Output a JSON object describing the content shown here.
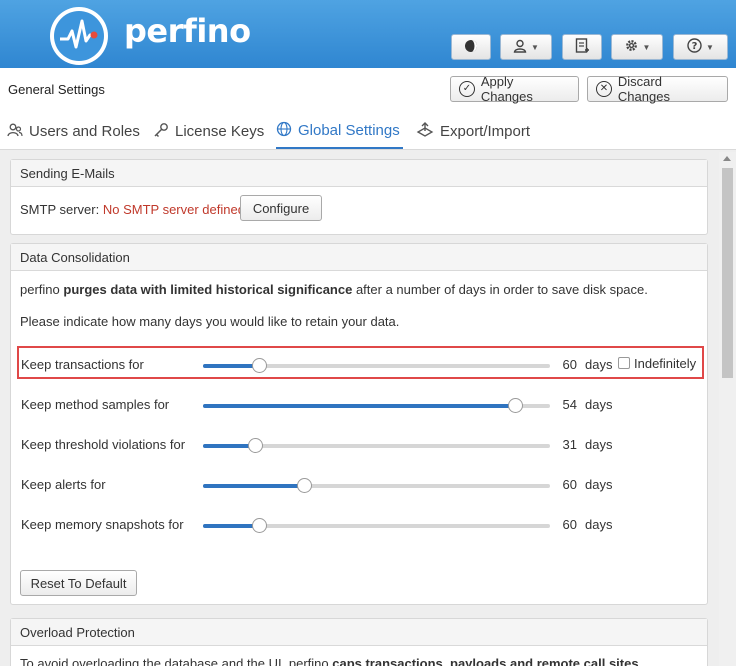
{
  "brand": {
    "name": "perfino",
    "accent": "#3d95dc"
  },
  "header_buttons": [
    {
      "icon": "theme-toggle-icon"
    },
    {
      "icon": "user-icon",
      "has_menu": true
    },
    {
      "icon": "add-document-icon"
    },
    {
      "icon": "gear-icon",
      "has_menu": true
    },
    {
      "icon": "help-icon",
      "has_menu": true
    }
  ],
  "toolbar": {
    "title": "General Settings",
    "apply_label": "Apply Changes",
    "discard_label": "Discard Changes"
  },
  "tabs": [
    {
      "label": "Users and Roles",
      "icon": "users-icon",
      "active": false
    },
    {
      "label": "License Keys",
      "icon": "key-icon",
      "active": false
    },
    {
      "label": "Global Settings",
      "icon": "globe-icon",
      "active": true
    },
    {
      "label": "Export/Import",
      "icon": "export-import-icon",
      "active": false
    }
  ],
  "email_panel": {
    "title": "Sending E-Mails",
    "smtp_label": "SMTP server:",
    "smtp_status": "No SMTP server defined",
    "configure_label": "Configure"
  },
  "consolidation": {
    "title": "Data Consolidation",
    "intro_prefix": "perfino",
    "intro_bold": "purges data with limited historical significance",
    "intro_suffix": "after a number of days in order to save disk space.",
    "instruction": "Please indicate how many days you would like to retain your data.",
    "indefinitely_label": "Indefinitely",
    "indefinitely_checked": false,
    "reset_label": "Reset To Default",
    "sliders": [
      {
        "label": "Keep transactions for",
        "value": "60",
        "unit": "days",
        "fraction": 0.16
      },
      {
        "label": "Keep method samples for",
        "value": "54",
        "unit": "days",
        "fraction": 0.9
      },
      {
        "label": "Keep threshold violations for",
        "value": "31",
        "unit": "days",
        "fraction": 0.15
      },
      {
        "label": "Keep alerts for",
        "value": "60",
        "unit": "days",
        "fraction": 0.29
      },
      {
        "label": "Keep memory snapshots for",
        "value": "60",
        "unit": "days",
        "fraction": 0.16
      }
    ]
  },
  "overload": {
    "title": "Overload Protection",
    "text_prefix": "To avoid overloading the database and the UI, perfino",
    "text_bold": "caps transactions, payloads and remote call sites"
  }
}
